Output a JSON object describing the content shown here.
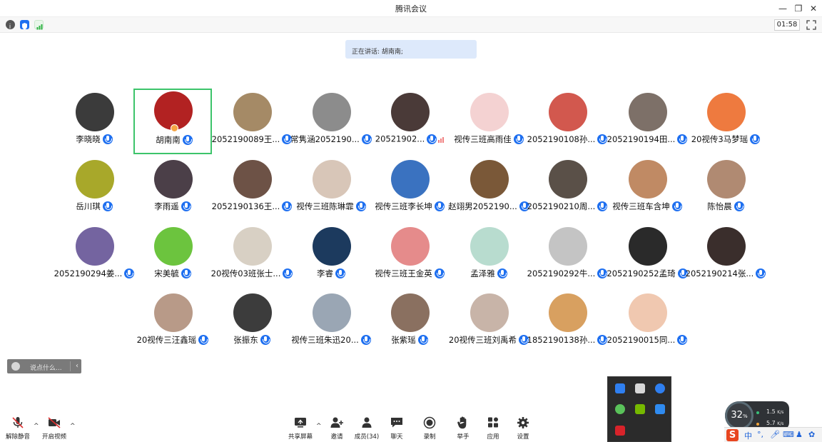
{
  "window": {
    "title": "腾讯会议",
    "minimize_icon": "minimize-icon",
    "restore_icon": "restore-icon",
    "close_icon": "close-icon"
  },
  "info_bar": {
    "icons": [
      "info-icon",
      "shield-icon",
      "network-signal-icon"
    ],
    "timer": "01:58",
    "fullscreen_icon": "fullscreen-icon"
  },
  "speaker_banner": {
    "text": "正在讲话: 胡南南;"
  },
  "participants": [
    {
      "name": "李晓晓",
      "mic": "on",
      "color": "#3b3b3b"
    },
    {
      "name": "胡南南",
      "mic": "on",
      "color": "#b22222",
      "active": true,
      "host": true
    },
    {
      "name": "2052190089王...",
      "mic": "on",
      "color": "#a58a66"
    },
    {
      "name": "常隽涵2052190...",
      "mic": "on",
      "color": "#8c8c8c"
    },
    {
      "name": "20521902...",
      "mic": "on",
      "color": "#4a3a38",
      "signal": true
    },
    {
      "name": "视传三班高雨佳",
      "mic": "on",
      "color": "#f4d2d2"
    },
    {
      "name": "2052190108孙...",
      "mic": "on",
      "color": "#d2584e"
    },
    {
      "name": "2052190194田...",
      "mic": "on",
      "color": "#7d7068"
    },
    {
      "name": "20视传3马梦瑶",
      "mic": "on",
      "color": "#ee7a3f"
    },
    {
      "name": "岳川琪",
      "mic": "on",
      "color": "#a8a82a"
    },
    {
      "name": "李雨遥",
      "mic": "on",
      "color": "#4b3f48"
    },
    {
      "name": "2052190136王...",
      "mic": "on",
      "color": "#6d5246"
    },
    {
      "name": "视传三班陈琳霏",
      "mic": "on",
      "color": "#d8c6b8"
    },
    {
      "name": "视传三班李长坤",
      "mic": "on",
      "color": "#3a72c0"
    },
    {
      "name": "赵翊男2052190...",
      "mic": "on",
      "color": "#7a5838"
    },
    {
      "name": "2052190210周...",
      "mic": "on",
      "color": "#5a5048"
    },
    {
      "name": "视传三班车含坤",
      "mic": "on",
      "color": "#c08a64"
    },
    {
      "name": "陈怡晨",
      "mic": "on",
      "color": "#b08a72"
    },
    {
      "name": "2052190294姜...",
      "mic": "on",
      "color": "#7464a0"
    },
    {
      "name": "宋美毓",
      "mic": "on",
      "color": "#6cc43e"
    },
    {
      "name": "20视传03班张士...",
      "mic": "on",
      "color": "#d8d0c4"
    },
    {
      "name": "李睿",
      "mic": "on",
      "color": "#1c3a5e"
    },
    {
      "name": "视传三班王金英",
      "mic": "on",
      "color": "#e58b8b"
    },
    {
      "name": "孟泽雅",
      "mic": "on",
      "color": "#b8dccf"
    },
    {
      "name": "2052190292牛...",
      "mic": "on",
      "color": "#c4c4c4"
    },
    {
      "name": "2052190252孟琦",
      "mic": "on",
      "color": "#2a2a2a"
    },
    {
      "name": "2052190214张...",
      "mic": "on",
      "color": "#3a2e2c"
    },
    {
      "name": "20视传三汪鑫瑶",
      "mic": "on",
      "color": "#b89a88"
    },
    {
      "name": "张振东",
      "mic": "on",
      "color": "#3c3c3c"
    },
    {
      "name": "视传三班朱迅20...",
      "mic": "on",
      "color": "#9aa6b4"
    },
    {
      "name": "张紫瑶",
      "mic": "on",
      "color": "#8a7060"
    },
    {
      "name": "20视传三班刘禹希",
      "mic": "on",
      "color": "#c8b4a8"
    },
    {
      "name": "1852190138孙...",
      "mic": "on",
      "color": "#d8a060"
    },
    {
      "name": "2052190015同...",
      "mic": "on",
      "color": "#f0c8b0"
    }
  ],
  "chat": {
    "placeholder": "说点什么...",
    "smile_icon": "emoji-icon",
    "collapse_icon": "chevron-left-icon"
  },
  "toolbar": {
    "unmute": "解除静音",
    "start_video": "开启视频",
    "share_screen": "共享屏幕",
    "invite": "邀请",
    "members": "成员(34)",
    "chat": "聊天",
    "record": "录制",
    "raise_hand": "举手",
    "apps": "应用",
    "settings": "设置"
  },
  "tray": {
    "icons": [
      "defender-icon",
      "security-center-icon",
      "bluetooth-icon",
      "wechat-icon",
      "nvidia-icon",
      "cloud-sync-icon",
      "wps-icon"
    ]
  },
  "meter": {
    "percent": "32",
    "percent_unit": "%",
    "upload": "1.5",
    "upload_unit": "K/s",
    "download": "5.7",
    "download_unit": "K/s"
  },
  "ime": {
    "logo": "S",
    "lang": "中",
    "icons": [
      "punctuation-icon",
      "voice-icon",
      "keyboard-icon",
      "skin-icon",
      "toolbox-icon"
    ]
  },
  "colors": {
    "accent": "#1e6ff0",
    "active_border": "#3cc46a",
    "banner_bg": "#dde9fb"
  }
}
